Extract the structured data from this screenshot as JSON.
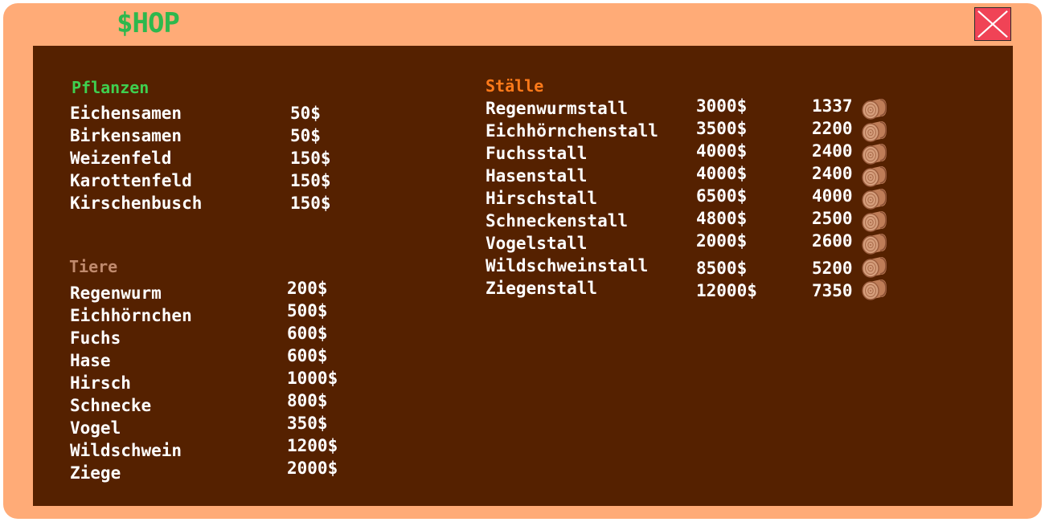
{
  "window": {
    "title": "$HOP",
    "colors": {
      "frame": "#ffab77",
      "panel": "#552100",
      "title": "#2db84d",
      "close": "#f04356"
    }
  },
  "pflanzen": {
    "title": "Pflanzen",
    "color": "#3fcf4f",
    "items": [
      {
        "name": "Eichensamen",
        "price": "50$"
      },
      {
        "name": "Birkensamen",
        "price": "50$"
      },
      {
        "name": "Weizenfeld",
        "price": "150$"
      },
      {
        "name": "Karottenfeld",
        "price": "150$"
      },
      {
        "name": "Kirschenbusch",
        "price": "150$"
      }
    ]
  },
  "tiere": {
    "title": "Tiere",
    "color": "#c08a6d",
    "items": [
      {
        "name": "Regenwurm",
        "price": "200$"
      },
      {
        "name": "Eichhörnchen",
        "price": "500$"
      },
      {
        "name": "Fuchs",
        "price": "600$"
      },
      {
        "name": "Hase",
        "price": "600$"
      },
      {
        "name": "Hirsch",
        "price": "1000$"
      },
      {
        "name": "Schnecke",
        "price": "800$"
      },
      {
        "name": "Vogel",
        "price": "350$"
      },
      {
        "name": "Wildschwein",
        "price": "1200$"
      },
      {
        "name": "Ziege",
        "price": "2000$"
      }
    ]
  },
  "staelle": {
    "title": "Ställe",
    "color": "#ff7a1a",
    "wood_icon": "wood-log-icon",
    "items": [
      {
        "name": "Regenwurmstall",
        "price": "3000$",
        "wood": "1337"
      },
      {
        "name": "Eichhörnchenstall",
        "price": "3500$",
        "wood": "2200"
      },
      {
        "name": "Fuchsstall",
        "price": "4000$",
        "wood": "2400"
      },
      {
        "name": "Hasenstall",
        "price": "4000$",
        "wood": "2400"
      },
      {
        "name": "Hirschstall",
        "price": "6500$",
        "wood": "4000"
      },
      {
        "name": "Schneckenstall",
        "price": "4800$",
        "wood": "2500"
      },
      {
        "name": "Vogelstall",
        "price": "2000$",
        "wood": "2600"
      },
      {
        "name": "Wildschweinstall",
        "price": "8500$",
        "wood": "5200"
      },
      {
        "name": "Ziegenstall",
        "price": "12000$",
        "wood": "7350"
      }
    ]
  }
}
